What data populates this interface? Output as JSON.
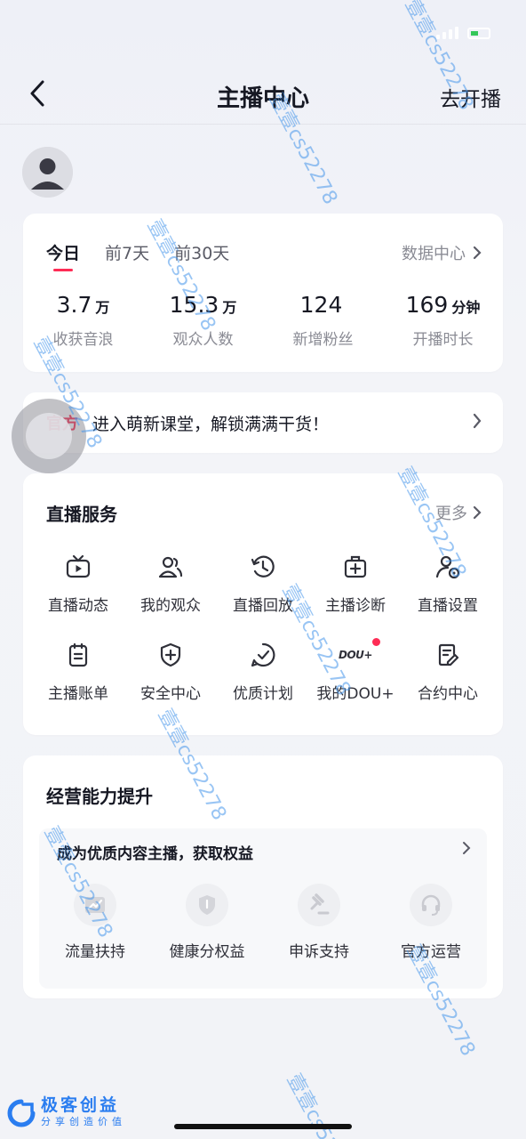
{
  "nav": {
    "title": "主播中心",
    "go_live": "去开播"
  },
  "stats": {
    "tabs": [
      "今日",
      "前7天",
      "前30天"
    ],
    "data_center": "数据中心",
    "items": [
      {
        "value": "3.7",
        "unit": "万",
        "label": "收获音浪"
      },
      {
        "value": "15.3",
        "unit": "万",
        "label": "观众人数"
      },
      {
        "value": "124",
        "unit": "",
        "label": "新增粉丝"
      },
      {
        "value": "169",
        "unit": "分钟",
        "label": "开播时长"
      }
    ]
  },
  "banner": {
    "tag": "官方",
    "text": "进入萌新课堂，解锁满满干货！"
  },
  "services": {
    "title": "直播服务",
    "more": "更多",
    "items": [
      {
        "label": "直播动态",
        "icon": "tv-icon"
      },
      {
        "label": "我的观众",
        "icon": "users-icon"
      },
      {
        "label": "直播回放",
        "icon": "history-icon"
      },
      {
        "label": "主播诊断",
        "icon": "medical-kit-icon"
      },
      {
        "label": "直播设置",
        "icon": "user-settings-icon"
      },
      {
        "label": "主播账单",
        "icon": "bill-icon"
      },
      {
        "label": "安全中心",
        "icon": "shield-plus-icon"
      },
      {
        "label": "优质计划",
        "icon": "check-circle-icon"
      },
      {
        "label": "我的DOU+",
        "icon": "dou-plus-icon",
        "badge_text": "DOU+"
      },
      {
        "label": "合约中心",
        "icon": "contract-icon"
      }
    ]
  },
  "business": {
    "title": "经营能力提升",
    "subtitle": "成为优质内容主播，获取权益",
    "items": [
      {
        "label": "流量扶持",
        "icon": "traffic-chart-icon"
      },
      {
        "label": "健康分权益",
        "icon": "shield-icon"
      },
      {
        "label": "申诉支持",
        "icon": "gavel-icon"
      },
      {
        "label": "官方运营",
        "icon": "headset-icon"
      }
    ]
  },
  "watermark": {
    "text": "壹壹cs52278"
  },
  "brand": {
    "name": "极客创益",
    "tagline": "分享创造价值"
  },
  "colors": {
    "accent": "#fe2c55",
    "brand": "#2a7df0"
  }
}
